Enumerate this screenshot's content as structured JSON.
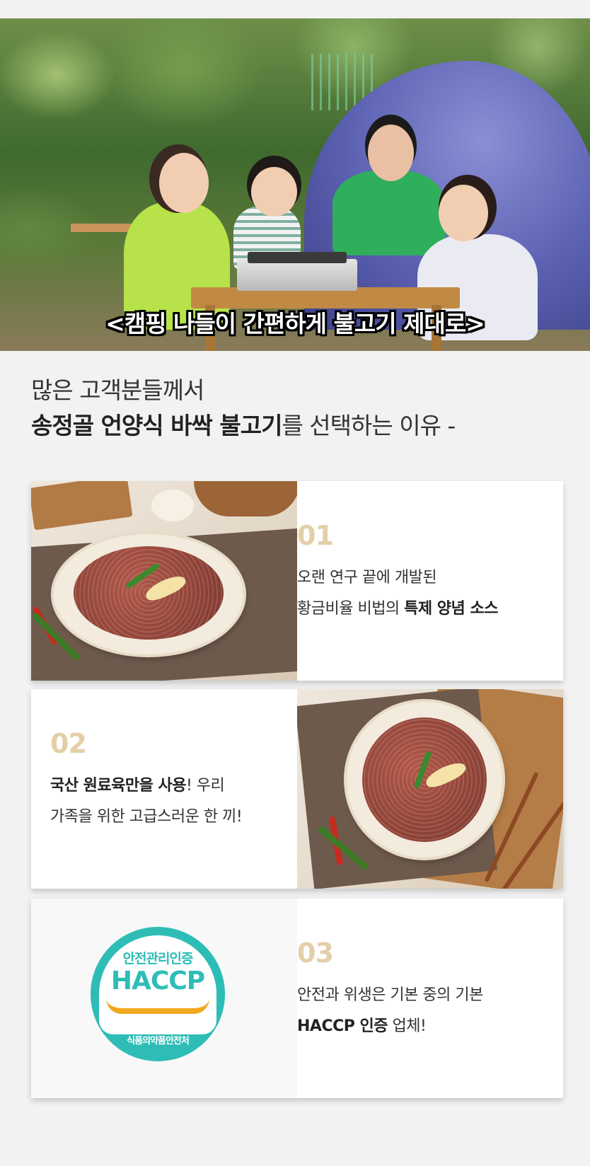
{
  "hero": {
    "caption": "<캠핑 나들이 간편하게 불고기 제대로>"
  },
  "headline": {
    "line1": "많은 고객분들께서",
    "line2_bold": "송정골 언양식 바싹 불고기",
    "line2_rest": "를 선택하는 이유 -"
  },
  "cards": [
    {
      "number": "01",
      "desc_line1": "오랜 연구 끝에 개발된",
      "desc_line2_pre": "황금비율 비법의 ",
      "desc_line2_bold": "특제 양념 소스"
    },
    {
      "number": "02",
      "desc_line1_bold": "국산 원료육만을 사용",
      "desc_line1_rest": "! 우리",
      "desc_line2": "가족을 위한 고급스러운 한 끼!"
    },
    {
      "number": "03",
      "desc_line1": "안전과 위생은 기본 중의 기본",
      "desc_line2_bold": "HACCP 인증",
      "desc_line2_rest": " 업체!",
      "badge": {
        "top": "안전관리인증",
        "middle": "HACCP",
        "bottom": "식품의약품안전처"
      }
    }
  ],
  "colors": {
    "number": "#e3cfa8",
    "haccp_teal": "#2ebdb6",
    "haccp_orange": "#f2a81d",
    "page_bg": "#f2f2f2"
  }
}
